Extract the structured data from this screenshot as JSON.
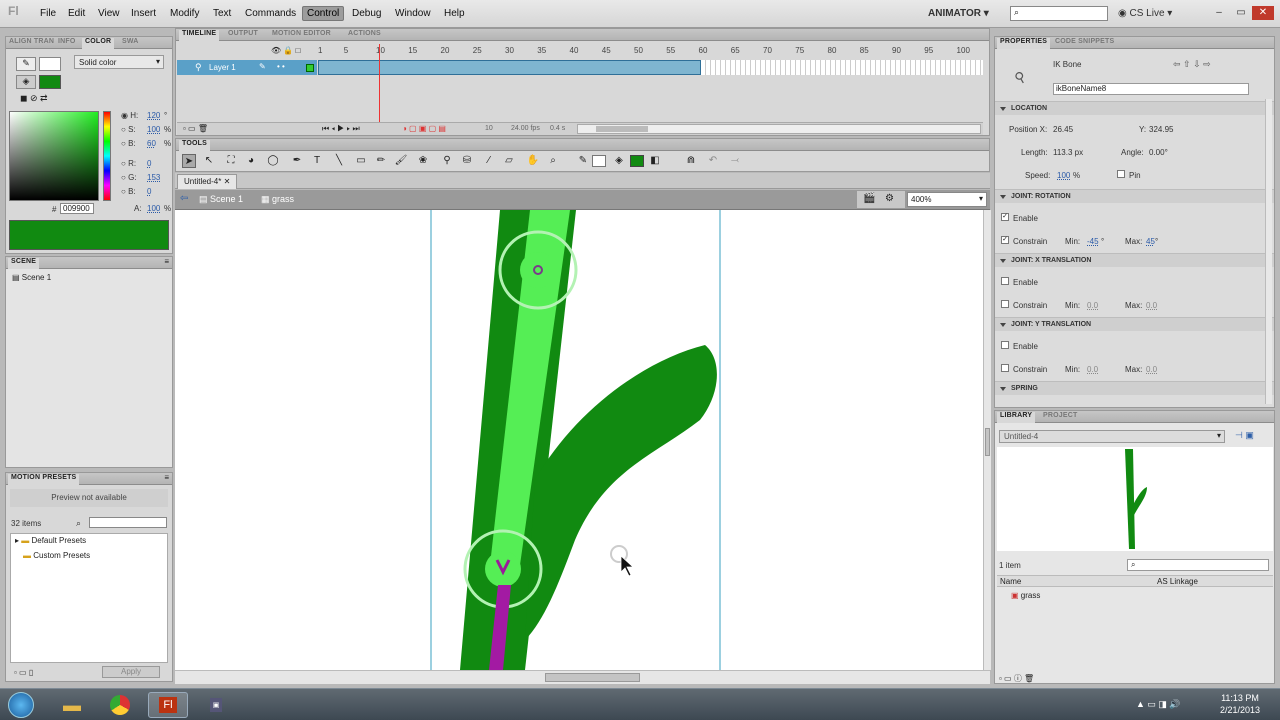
{
  "menus": [
    "File",
    "Edit",
    "View",
    "Insert",
    "Modify",
    "Text",
    "Commands",
    "Control",
    "Debug",
    "Window",
    "Help"
  ],
  "workspace": "ANIMATOR",
  "cslive": "CS Live",
  "left_tabs": [
    "ALIGN TRAN",
    "INFO",
    "COLOR",
    "SWA"
  ],
  "color": {
    "type": "Solid color",
    "h": "120",
    "s": "100",
    "b": "60",
    "r": "0",
    "g": "153",
    "bl": "0",
    "a": "100",
    "hex": "009900",
    "h_lbl": "H:",
    "s_lbl": "S:",
    "b_lbl": "B:",
    "r_lbl": "R:",
    "g_lbl": "G:",
    "bl_lbl": "B:",
    "a_lbl": "A:",
    "deg": "°",
    "pct": "%",
    "hash": "#",
    "fill_color": "#118a11"
  },
  "scene_panel": {
    "title": "SCENE",
    "item": "Scene 1"
  },
  "motion_presets": {
    "title": "MOTION PRESETS",
    "preview": "Preview not available",
    "count": "32 items",
    "folders": [
      "Default Presets",
      "Custom Presets"
    ],
    "apply": "Apply"
  },
  "timeline": {
    "tabs": [
      "TIMELINE",
      "OUTPUT",
      "MOTION EDITOR",
      "ACTIONS"
    ],
    "frame_numbers": [
      "1",
      "5",
      "10",
      "15",
      "20",
      "25",
      "30",
      "35",
      "40",
      "45",
      "50",
      "55",
      "60",
      "65",
      "70",
      "75",
      "80",
      "85",
      "90",
      "95",
      "100"
    ],
    "layer": "Layer 1",
    "current_frame": "10",
    "fps": "24.00",
    "fps_unit": "fps",
    "time": "0.4",
    "time_unit": "s",
    "playhead_frame": 10
  },
  "tools_title": "TOOLS",
  "breadcrumb": {
    "doc_tab": "Untitled-4*",
    "scene": "Scene 1",
    "symbol": "grass",
    "zoom": "400%"
  },
  "properties": {
    "tabs": [
      "PROPERTIES",
      "CODE SNIPPETS"
    ],
    "type": "IK Bone",
    "name": "ikBoneName8",
    "location_title": "LOCATION",
    "position_x_label": "Position X:",
    "position_x": "26.45",
    "y_label": "Y:",
    "y": "324.95",
    "length_label": "Length:",
    "length": "113.3 px",
    "angle_label": "Angle:",
    "angle": "0.00°",
    "speed_label": "Speed:",
    "speed": "100",
    "speed_unit": "%",
    "pin": "Pin",
    "rot_title": "JOINT: ROTATION",
    "enable": "Enable",
    "constrain": "Constrain",
    "min": "Min:",
    "max": "Max:",
    "rot_min": "-45",
    "rot_max": "45",
    "deg": "°",
    "xt_title": "JOINT: X TRANSLATION",
    "xt_min": "0.0",
    "xt_max": "0.0",
    "yt_title": "JOINT: Y TRANSLATION",
    "yt_min": "0.0",
    "yt_max": "0.0",
    "spring_title": "SPRING"
  },
  "library": {
    "tabs": [
      "LIBRARY",
      "PROJECT"
    ],
    "doc": "Untitled-4",
    "count": "1 item",
    "col_name": "Name",
    "col_linkage": "AS Linkage",
    "item": "grass"
  },
  "clock": {
    "time": "11:13 PM",
    "date": "2/21/2013"
  }
}
